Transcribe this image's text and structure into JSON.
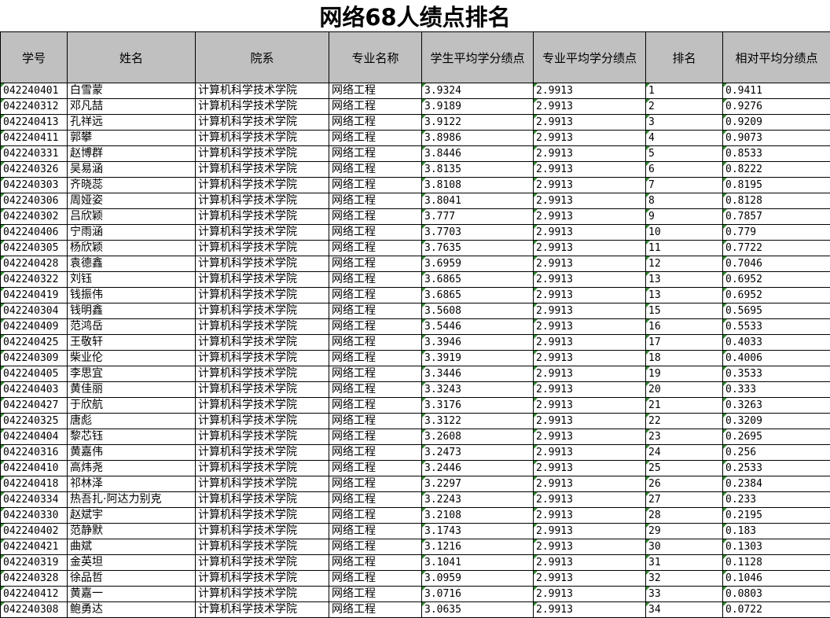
{
  "title": "网络68人绩点排名",
  "columns": [
    "学号",
    "姓名",
    "院系",
    "专业名称",
    "学生平均学分绩点",
    "专业平均学分绩点",
    "排名",
    "相对平均分绩点"
  ],
  "colors": {
    "header_bg": "#c0c0c0",
    "flag": "#2e8b2e",
    "border": "#000000"
  },
  "rows": [
    [
      "042240401",
      "白雪蒙",
      "计算机科学技术学院",
      "网络工程",
      "3.9324",
      "2.9913",
      "1",
      "0.9411"
    ],
    [
      "042240312",
      "邓凡喆",
      "计算机科学技术学院",
      "网络工程",
      "3.9189",
      "2.9913",
      "2",
      "0.9276"
    ],
    [
      "042240413",
      "孔祥远",
      "计算机科学技术学院",
      "网络工程",
      "3.9122",
      "2.9913",
      "3",
      "0.9209"
    ],
    [
      "042240411",
      "郭攀",
      "计算机科学技术学院",
      "网络工程",
      "3.8986",
      "2.9913",
      "4",
      "0.9073"
    ],
    [
      "042240331",
      "赵博群",
      "计算机科学技术学院",
      "网络工程",
      "3.8446",
      "2.9913",
      "5",
      "0.8533"
    ],
    [
      "042240326",
      "吴易涵",
      "计算机科学技术学院",
      "网络工程",
      "3.8135",
      "2.9913",
      "6",
      "0.8222"
    ],
    [
      "042240303",
      "齐晓蕊",
      "计算机科学技术学院",
      "网络工程",
      "3.8108",
      "2.9913",
      "7",
      "0.8195"
    ],
    [
      "042240306",
      "周娅姿",
      "计算机科学技术学院",
      "网络工程",
      "3.8041",
      "2.9913",
      "8",
      "0.8128"
    ],
    [
      "042240302",
      "吕欣颖",
      "计算机科学技术学院",
      "网络工程",
      "3.777",
      "2.9913",
      "9",
      "0.7857"
    ],
    [
      "042240406",
      "宁雨涵",
      "计算机科学技术学院",
      "网络工程",
      "3.7703",
      "2.9913",
      "10",
      "0.779"
    ],
    [
      "042240305",
      "杨欣颖",
      "计算机科学技术学院",
      "网络工程",
      "3.7635",
      "2.9913",
      "11",
      "0.7722"
    ],
    [
      "042240428",
      "袁德鑫",
      "计算机科学技术学院",
      "网络工程",
      "3.6959",
      "2.9913",
      "12",
      "0.7046"
    ],
    [
      "042240322",
      "刘钰",
      "计算机科学技术学院",
      "网络工程",
      "3.6865",
      "2.9913",
      "13",
      "0.6952"
    ],
    [
      "042240419",
      "钱振伟",
      "计算机科学技术学院",
      "网络工程",
      "3.6865",
      "2.9913",
      "13",
      "0.6952"
    ],
    [
      "042240304",
      "钱明鑫",
      "计算机科学技术学院",
      "网络工程",
      "3.5608",
      "2.9913",
      "15",
      "0.5695"
    ],
    [
      "042240409",
      "范鸿岳",
      "计算机科学技术学院",
      "网络工程",
      "3.5446",
      "2.9913",
      "16",
      "0.5533"
    ],
    [
      "042240425",
      "王敬轩",
      "计算机科学技术学院",
      "网络工程",
      "3.3946",
      "2.9913",
      "17",
      "0.4033"
    ],
    [
      "042240309",
      "柴业伦",
      "计算机科学技术学院",
      "网络工程",
      "3.3919",
      "2.9913",
      "18",
      "0.4006"
    ],
    [
      "042240405",
      "李思宜",
      "计算机科学技术学院",
      "网络工程",
      "3.3446",
      "2.9913",
      "19",
      "0.3533"
    ],
    [
      "042240403",
      "黄佳丽",
      "计算机科学技术学院",
      "网络工程",
      "3.3243",
      "2.9913",
      "20",
      "0.333"
    ],
    [
      "042240427",
      "于欣航",
      "计算机科学技术学院",
      "网络工程",
      "3.3176",
      "2.9913",
      "21",
      "0.3263"
    ],
    [
      "042240325",
      "唐彪",
      "计算机科学技术学院",
      "网络工程",
      "3.3122",
      "2.9913",
      "22",
      "0.3209"
    ],
    [
      "042240404",
      "黎芯钰",
      "计算机科学技术学院",
      "网络工程",
      "3.2608",
      "2.9913",
      "23",
      "0.2695"
    ],
    [
      "042240316",
      "黄嘉伟",
      "计算机科学技术学院",
      "网络工程",
      "3.2473",
      "2.9913",
      "24",
      "0.256"
    ],
    [
      "042240410",
      "高炜尧",
      "计算机科学技术学院",
      "网络工程",
      "3.2446",
      "2.9913",
      "25",
      "0.2533"
    ],
    [
      "042240418",
      "祁林泽",
      "计算机科学技术学院",
      "网络工程",
      "3.2297",
      "2.9913",
      "26",
      "0.2384"
    ],
    [
      "042240334",
      "热吾扎·阿达力别克",
      "计算机科学技术学院",
      "网络工程",
      "3.2243",
      "2.9913",
      "27",
      "0.233"
    ],
    [
      "042240330",
      "赵斌宇",
      "计算机科学技术学院",
      "网络工程",
      "3.2108",
      "2.9913",
      "28",
      "0.2195"
    ],
    [
      "042240402",
      "范静默",
      "计算机科学技术学院",
      "网络工程",
      "3.1743",
      "2.9913",
      "29",
      "0.183"
    ],
    [
      "042240421",
      "曲斌",
      "计算机科学技术学院",
      "网络工程",
      "3.1216",
      "2.9913",
      "30",
      "0.1303"
    ],
    [
      "042240319",
      "金英坦",
      "计算机科学技术学院",
      "网络工程",
      "3.1041",
      "2.9913",
      "31",
      "0.1128"
    ],
    [
      "042240328",
      "徐品哲",
      "计算机科学技术学院",
      "网络工程",
      "3.0959",
      "2.9913",
      "32",
      "0.1046"
    ],
    [
      "042240412",
      "黄嘉一",
      "计算机科学技术学院",
      "网络工程",
      "3.0716",
      "2.9913",
      "33",
      "0.0803"
    ],
    [
      "042240308",
      "鲍勇达",
      "计算机科学技术学院",
      "网络工程",
      "3.0635",
      "2.9913",
      "34",
      "0.0722"
    ]
  ]
}
